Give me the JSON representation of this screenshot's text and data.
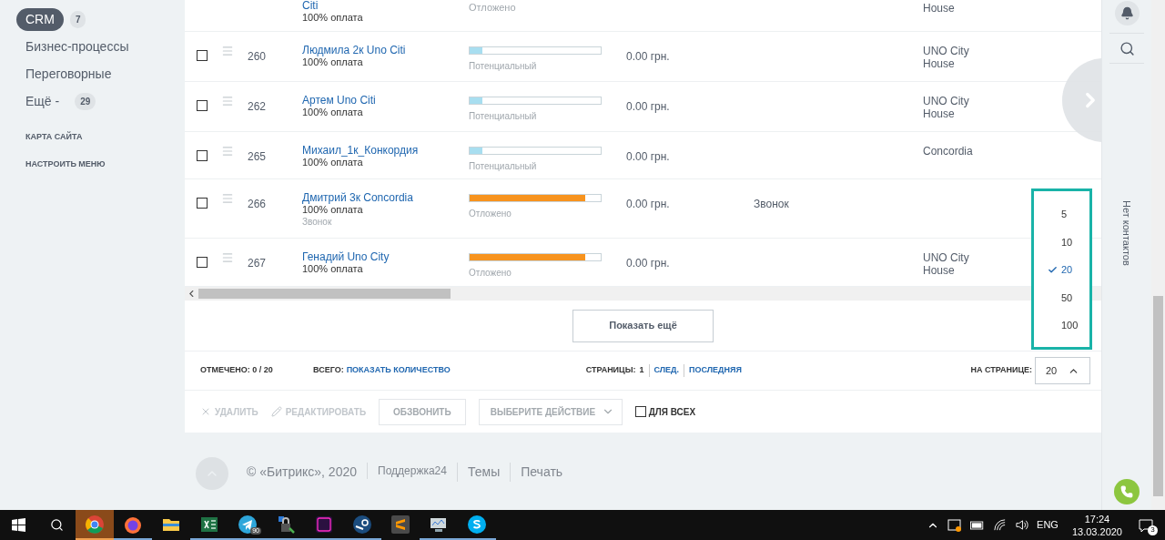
{
  "sidebar": {
    "items": [
      {
        "label": "CRM",
        "selected": true,
        "counter": "7"
      },
      {
        "label": "Бизнес-процессы",
        "selected": false
      },
      {
        "label": "Переговорные",
        "selected": false
      },
      {
        "label": "Ещё -",
        "selected": false,
        "counter": "29"
      }
    ],
    "links": [
      "КАРТА САЙТА",
      "НАСТРОИТЬ МЕНЮ"
    ]
  },
  "table": {
    "partial_row": {
      "name": "Citi",
      "subtitle": "100% оплата",
      "stage": "Отложено",
      "company": "House"
    },
    "rows": [
      {
        "checked": false,
        "id": "260",
        "name": "Людмила 2к Uno Citi",
        "subtitle": "100% оплата",
        "stage": {
          "label": "Потенциальный",
          "level": 0.1,
          "color": "#a8def0"
        },
        "sum": "0.00 грн.",
        "company": "UNO City House"
      },
      {
        "checked": false,
        "id": "262",
        "name": "Артем Uno Citi",
        "subtitle": "100% оплата",
        "stage": {
          "label": "Потенциальный",
          "level": 0.1,
          "color": "#a8def0"
        },
        "sum": "0.00 грн.",
        "company": "UNO City House"
      },
      {
        "checked": false,
        "id": "265",
        "name": "Михаил_1к_Конкордия",
        "subtitle": "100% оплата",
        "stage": {
          "label": "Потенциальный",
          "level": 0.1,
          "color": "#a8def0"
        },
        "sum": "0.00 грн.",
        "company": "Concordia"
      },
      {
        "checked": false,
        "id": "266",
        "name": "Дмитрий 3к Concordia",
        "subtitle": "100% оплата",
        "note": "Звонок",
        "stage": {
          "label": "Отложено",
          "level": 0.88,
          "color": "#f7931e"
        },
        "sum": "0.00 грн.",
        "activity": "Звонок"
      },
      {
        "checked": false,
        "id": "267",
        "name": "Генадий Uno City",
        "subtitle": "100% оплата",
        "stage": {
          "label": "Отложено",
          "level": 0.88,
          "color": "#f7931e"
        },
        "sum": "0.00 грн.",
        "company": "UNO City House"
      }
    ],
    "show_more": "Показать ещё"
  },
  "pagination": {
    "checked_label": "ОТМЕЧЕНО: 0 / 20",
    "total_label": "ВСЕГО:",
    "total_link": "ПОКАЗАТЬ КОЛИЧЕСТВО",
    "pages_label": "СТРАНИЦЫ:",
    "current_page": "1",
    "next": "СЛЕД.",
    "last": "ПОСЛЕДНЯЯ",
    "per_page_label": "НА СТРАНИЦЕ:",
    "per_page": {
      "value": "20",
      "expanded": true,
      "options": [
        {
          "label": "5",
          "selected": false
        },
        {
          "label": "10",
          "selected": false
        },
        {
          "label": "20",
          "selected": true
        },
        {
          "label": "50",
          "selected": false
        },
        {
          "label": "100",
          "selected": false
        }
      ]
    }
  },
  "actions": {
    "delete": {
      "label": "УДАЛИТЬ",
      "disabled": true
    },
    "edit": {
      "label": "РЕДАКТИРОВАТЬ",
      "disabled": true
    },
    "call": "ОБЗВОНИТЬ",
    "select_action": "ВЫБЕРИТЕ ДЕЙСТВИЕ",
    "for_all": {
      "label": "ДЛЯ ВСЕХ",
      "checked": false
    }
  },
  "footer": [
    "© «Битрикс», 2020",
    "Поддержка24",
    "Темы",
    "Печать"
  ],
  "right_panel": {
    "empty_text": "Нет контактов"
  },
  "taskbar": {
    "apps": [
      {
        "kind": "ring",
        "active": true,
        "running": true
      },
      {
        "kind": "globe",
        "active": false,
        "running": true
      },
      {
        "kind": "folder",
        "active": false,
        "running": false
      },
      {
        "kind": "sheet",
        "active": false,
        "running": true
      },
      {
        "kind": "plane",
        "active": false,
        "running": true,
        "badge": "90"
      },
      {
        "kind": "lock",
        "active": false,
        "running": true
      },
      {
        "kind": "ps",
        "active": false,
        "running": true
      },
      {
        "kind": "steam",
        "active": false,
        "running": true
      },
      {
        "kind": "sublime",
        "active": false,
        "running": false
      },
      {
        "kind": "monitor",
        "active": false,
        "running": true
      },
      {
        "kind": "skype",
        "active": false,
        "running": true
      }
    ],
    "language": "ENG",
    "time": "17:24",
    "date": "13.03.2020",
    "notifications": "3"
  }
}
